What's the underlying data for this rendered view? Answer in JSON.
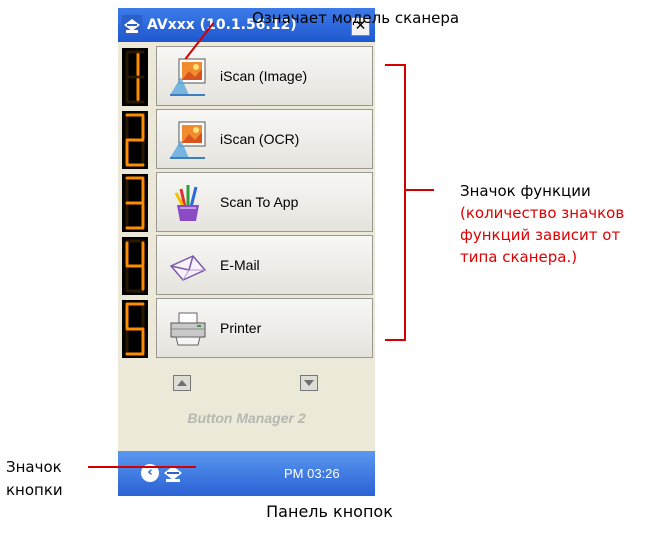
{
  "window": {
    "title": "AVxxx (10.1.56.12)",
    "close_label": "✕"
  },
  "buttons": [
    {
      "digit": "1",
      "label": "iScan (Image)",
      "icon": "scan-image-icon"
    },
    {
      "digit": "2",
      "label": "iScan (OCR)",
      "icon": "scan-ocr-icon"
    },
    {
      "digit": "3",
      "label": "Scan To App",
      "icon": "brush-cup-icon"
    },
    {
      "digit": "4",
      "label": "E-Mail",
      "icon": "envelope-icon"
    },
    {
      "digit": "5",
      "label": "Printer",
      "icon": "printer-icon"
    }
  ],
  "product_name": "Button Manager 2",
  "taskbar": {
    "time": "PM 03:26"
  },
  "annotations": {
    "model": "Означает модель сканера",
    "function_icon": "Значок функции",
    "function_icon_note": "(количество значков функций зависит от типа сканера.)",
    "button_icon": "Значок кнопки",
    "caption": "Панель кнопок"
  },
  "colors": {
    "annotation_red": "#e00000",
    "led_orange": "#ff8c00",
    "titlebar_blue": "#1e58d0"
  }
}
